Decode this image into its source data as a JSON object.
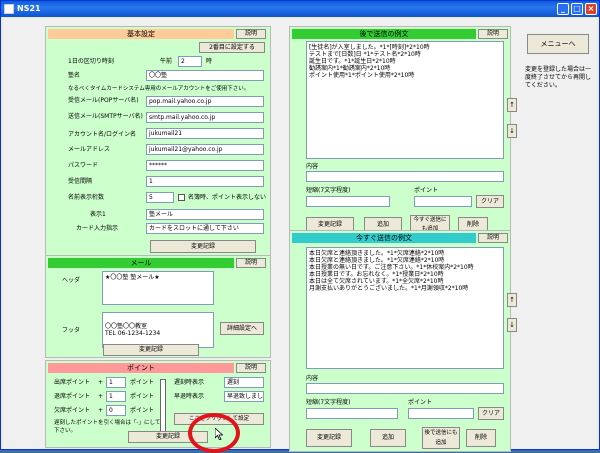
{
  "window": {
    "title": "NS21"
  },
  "basic": {
    "title": "基本設定",
    "help": "説明",
    "reset_time_btn": "2番目に設定する",
    "reset_time_label": "1日の区切り時刻",
    "ampm": "午前",
    "hour": "2",
    "hour_unit": "時",
    "shop_name_label": "塾名",
    "shop_name": "〇〇塾",
    "note": "なるべくタイムカードシステム専用のメールアカウントをご使用下さい。",
    "pop_label": "受信メール(POPサーバ名)",
    "pop": "pop.mail.yahoo.co.jp",
    "smtp_label": "送信メール(SMTPサーバ名)",
    "smtp": "smtp.mail.yahoo.co.jp",
    "account_label": "アカウント名/ログイン名",
    "account": "jukumail21",
    "email_label": "メールアドレス",
    "email": "jukumail21@yahoo.co.jp",
    "password_label": "パスワード",
    "password": "******",
    "interval_label": "受信間隔",
    "interval": "1",
    "digits_label": "名前表示桁数",
    "digits": "5",
    "hide_points_label": "名簿時、ポイント表示しない",
    "display1_label": "表示1",
    "display1": "塾メール",
    "card_label": "カード入力指示",
    "card": "カードをスロットに通して下さい",
    "save_btn": "変更記録"
  },
  "mail": {
    "title": "メール",
    "help": "説明",
    "header_label": "ヘッダ",
    "header_text": "★〇〇塾 塾メール★",
    "footer_label": "フッタ",
    "footer_lines": [
      "〇〇塾〇〇教室",
      "TEL 06-1234-1234"
    ],
    "detail_btn": "詳細設定へ",
    "save_btn": "変更記録"
  },
  "points": {
    "title": "ポイント",
    "help": "説明",
    "rows": [
      {
        "label": "出席ポイント",
        "op": "+",
        "value": "1",
        "unit": "ポイント"
      },
      {
        "label": "退席ポイント",
        "op": "+",
        "value": "1",
        "unit": "ポイント"
      },
      {
        "label": "欠席ポイント",
        "op": "+",
        "value": "0",
        "unit": "ポイント"
      }
    ],
    "note": "遅刻したポイントを引く場合は「-」にして下さい。",
    "late_label": "遅刻時表示",
    "late_value": "遅刻",
    "early_label": "早退時表示",
    "early_value": "早退致しました",
    "detail_btn": "ここをクリックして設定",
    "save_btn": "変更記録"
  },
  "latest_news": {
    "title": "後で送信の例文",
    "help": "説明",
    "lines": [
      "[生徒名]が入室しました。*1*[時刻]*2*10時",
      "テストまで[日数]日 *1*テスト名*2*10時",
      "誕生日です。*1*誕生日*2*10時",
      "勧誘案内*1*勧誘案内*2*10時",
      "ポイント使用*1*ポイント使用*2*10時"
    ],
    "content_label": "内容",
    "short_label": "短縮(7文字程度)",
    "point_label": "ポイント",
    "clear_btn": "クリア",
    "save_btn": "変更記録",
    "add_btn": "追加",
    "send_btn": "今すぐ送信にも追加",
    "delete_btn": "削除"
  },
  "now_news": {
    "title": "今すぐ送信の例文",
    "help": "説明",
    "lines": [
      "本日欠席と連絡頂きました。*1*欠席連絡*2*10時",
      "本日欠席と連絡頂きました。*1*欠席連絡*2*10時",
      "本日授業の無い日です。ご注意下さい。*1*休校案内*2*10時",
      "本日授業日です。お忘れなく。*1*授業日*2*10時",
      "本日は全て欠席されています。*1*全欠席*2*10時",
      "月謝支払いありがとうございました。*1*月謝領収*2*10時"
    ],
    "content_label": "内容",
    "short_label": "短縮(7文字程度)",
    "point_label": "ポイント",
    "clear_btn": "クリア",
    "save_btn": "変更記録",
    "add_btn": "追加",
    "send_btn": "後で送信にも追加",
    "delete_btn": "削除"
  },
  "side": {
    "menu_btn": "メニューへ",
    "note": "変更を登録した場合は一度終了させてから再開してください。"
  }
}
